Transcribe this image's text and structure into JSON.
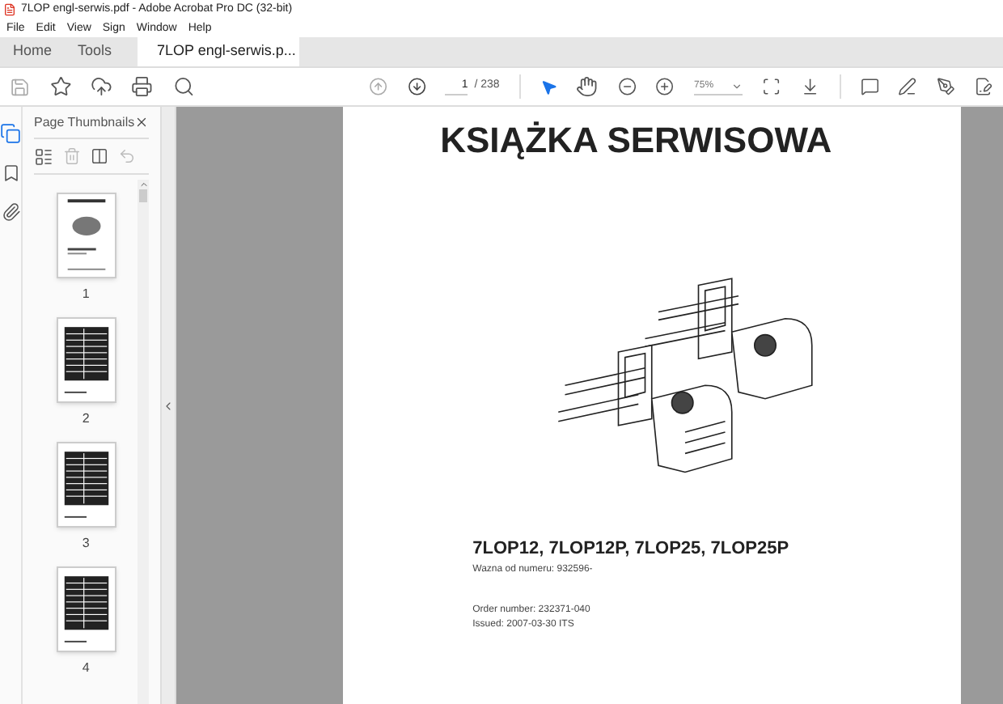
{
  "window": {
    "title": "7LOP engl-serwis.pdf - Adobe Acrobat Pro DC (32-bit)"
  },
  "menu": [
    "File",
    "Edit",
    "View",
    "Sign",
    "Window",
    "Help"
  ],
  "tabs": [
    {
      "label": "Home",
      "selected": false
    },
    {
      "label": "Tools",
      "selected": false
    },
    {
      "label": "7LOP engl-serwis.p...",
      "selected": true
    }
  ],
  "toolbar": {
    "page": "1",
    "page_total": "/ 238",
    "zoom": "75%"
  },
  "sidebar": {
    "title": "Page Thumbnails",
    "thumbnails": [
      {
        "label": "1",
        "kind": "cover"
      },
      {
        "label": "2",
        "kind": "table"
      },
      {
        "label": "3",
        "kind": "table"
      },
      {
        "label": "4",
        "kind": "table"
      }
    ]
  },
  "document": {
    "title": "KSIĄŻKA SERWISOWA",
    "models": "7LOP12, 7LOP12P, 7LOP25, 7LOP25P",
    "valid_from": "Wazna od numeru: 932596-",
    "order_number": "Order number: 232371-040",
    "issued": "Issued: 2007-03-30 ITS"
  }
}
